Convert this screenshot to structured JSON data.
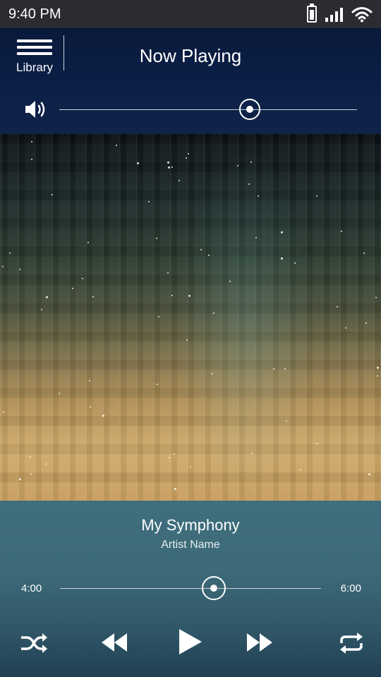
{
  "status_bar": {
    "time": "9:40 PM",
    "icons": [
      "battery-icon",
      "signal-icon",
      "wifi-icon"
    ]
  },
  "header": {
    "library_label": "Library",
    "title": "Now Playing",
    "icons": [
      "hamburger-menu-icon",
      "speaker-volume-icon"
    ]
  },
  "volume": {
    "level": 0.64
  },
  "artwork": {
    "description_icon": "album-artwork"
  },
  "track": {
    "title": "My Symphony",
    "artist": "Artist Name",
    "elapsed": "4:00",
    "duration": "6:00",
    "progress_fraction": 0.59
  },
  "controls": {
    "icons": [
      "shuffle-icon",
      "rewind-icon",
      "play-icon",
      "fast-forward-icon",
      "repeat-icon"
    ]
  },
  "colors": {
    "statusbar": "#2a2c31",
    "header": "#0b1f48",
    "player_panel": "#3f6e7e",
    "accent": "#ffffff"
  }
}
